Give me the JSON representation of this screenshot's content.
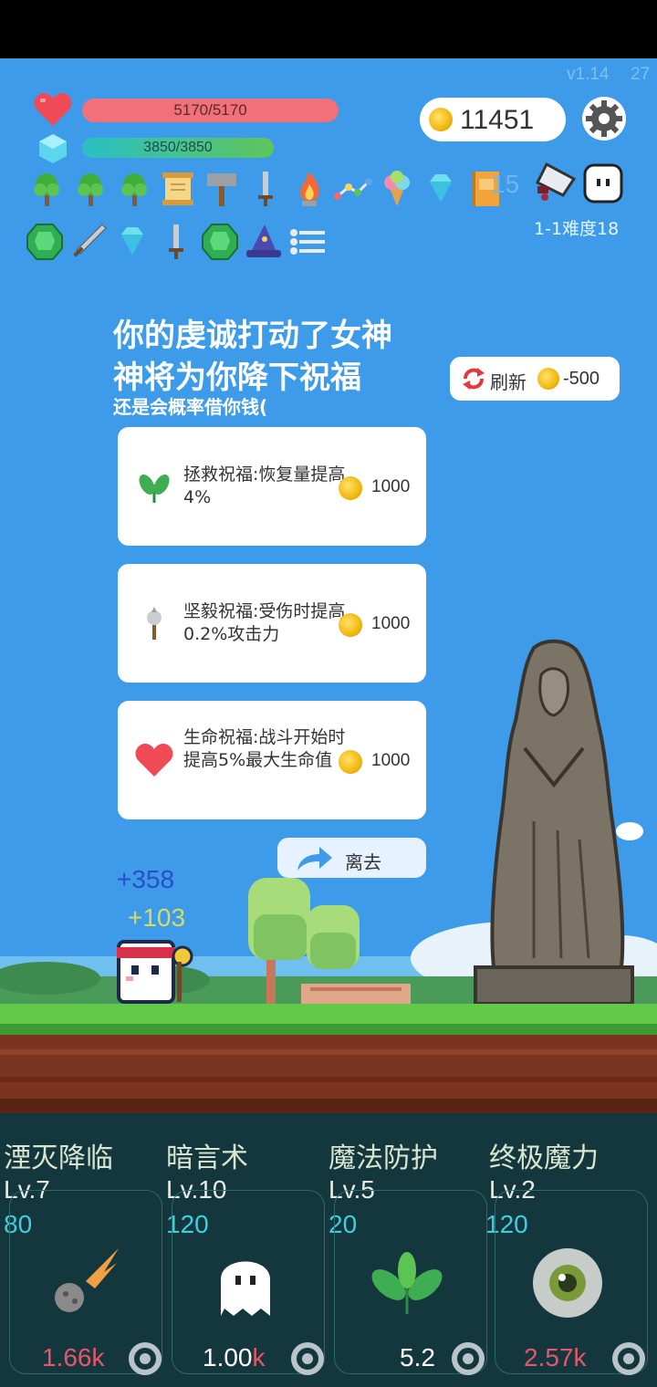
{
  "hud": {
    "version": "v1.14",
    "fps": "27",
    "hp_text": "5170/5170",
    "mp_text": "3850/3850",
    "gold": "11451",
    "stage_text": "1-1难度18",
    "faded_number": "15"
  },
  "items_row1": [
    "tree-icon",
    "tree-icon",
    "tree-icon",
    "scroll-icon",
    "hammer-icon",
    "dagger-icon",
    "fire-icon",
    "chain-icon",
    "ice-cream-icon",
    "diamond-icon",
    "book-icon",
    "meat-cleaver-icon",
    "ghost-icon"
  ],
  "items_row2": [
    "emerald-icon",
    "sword-icon",
    "diamond-icon",
    "dagger-icon",
    "emerald-icon",
    "wizard-hat-icon",
    "lines-icon"
  ],
  "event": {
    "title_line1": "你的虔诚打动了女神",
    "title_line2": "神将为你降下祝福",
    "subtitle": "还是会概率借你钱(",
    "refresh_label": "刷新",
    "refresh_cost": "-500",
    "leave_label": "离去",
    "cards": [
      {
        "icon": "leaf-icon",
        "text": "拯救祝福:恢复量提高4%",
        "cost": "1000"
      },
      {
        "icon": "mace-icon",
        "text": "坚毅祝福:受伤时提高0.2%攻击力",
        "cost": "1000"
      },
      {
        "icon": "heart-icon",
        "text": "生命祝福:战斗开始时提高5%最大生命值",
        "cost": "1000"
      }
    ]
  },
  "floating": {
    "plus_blue": "+358",
    "plus_yellow": "+103"
  },
  "skills": [
    {
      "name": "湮灭降临",
      "level": "Lv.7",
      "cost": "80",
      "value": "1.66",
      "unit": "k",
      "value_color": "#e8566a",
      "icon": "meteor-icon"
    },
    {
      "name": "暗言术",
      "level": "Lv.10",
      "cost": "120",
      "value": "1.00",
      "unit": "k",
      "value_color": "#ffffff",
      "icon": "ghost-icon"
    },
    {
      "name": "魔法防护",
      "level": "Lv.5",
      "cost": "20",
      "value": "5.2",
      "unit": "",
      "value_color": "#ffffff",
      "icon": "leaf-icon"
    },
    {
      "name": "终极魔力",
      "level": "Lv.2",
      "cost": "120",
      "value": "2.57",
      "unit": "k",
      "value_color": "#e8566a",
      "icon": "eye-icon"
    }
  ],
  "colors": {
    "sky": "#3d9bea",
    "hp_bar": "#f2707a",
    "skill_panel": "#14373e"
  }
}
